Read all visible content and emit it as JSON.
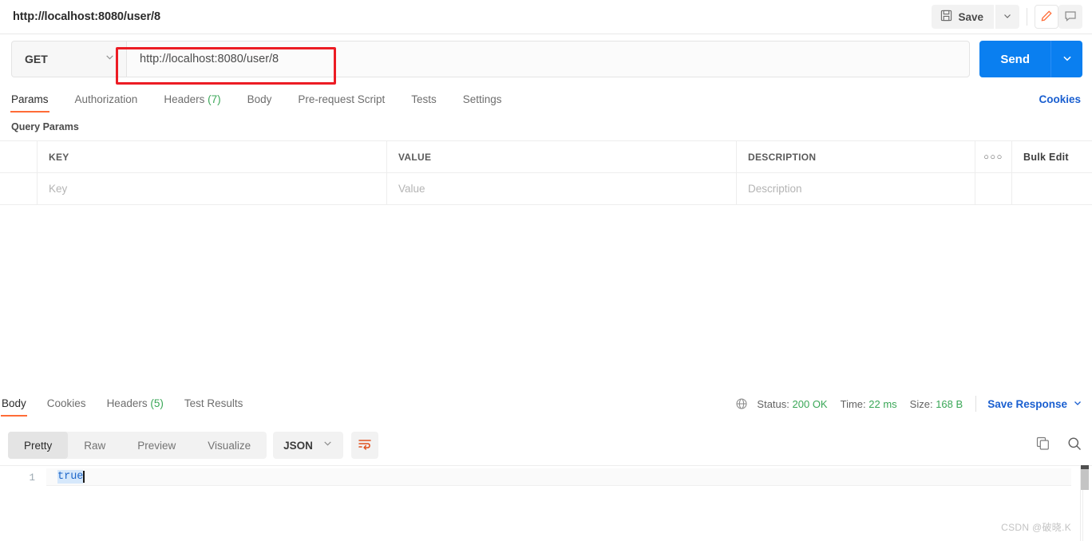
{
  "topbar": {
    "request_title": "http://localhost:8080/user/8",
    "save_label": "Save",
    "save_icon": "floppy-disk-icon",
    "save_caret_icon": "chevron-down-icon",
    "edit_icon": "pencil-icon",
    "comment_icon": "comment-icon",
    "accent_edit_color": "#ff6c37"
  },
  "url_bar": {
    "method": "GET",
    "method_caret_icon": "chevron-down-icon",
    "url": "http://localhost:8080/user/8",
    "send_label": "Send",
    "send_caret_icon": "chevron-down-icon",
    "send_color": "#0a7ff0",
    "highlight_color": "#ec1c24"
  },
  "request_tabs": {
    "items": [
      {
        "label": "Params",
        "active": true
      },
      {
        "label": "Authorization",
        "active": false
      },
      {
        "label": "Headers",
        "count": "(7)",
        "active": false
      },
      {
        "label": "Body",
        "active": false
      },
      {
        "label": "Pre-request Script",
        "active": false
      },
      {
        "label": "Tests",
        "active": false
      },
      {
        "label": "Settings",
        "active": false
      }
    ],
    "cookies_label": "Cookies",
    "active_underline_color": "#ff6c37"
  },
  "query_params": {
    "section_title": "Query Params",
    "columns": [
      "KEY",
      "VALUE",
      "DESCRIPTION"
    ],
    "more_icon": "ellipsis-icon",
    "bulk_edit_label": "Bulk Edit",
    "row_placeholders": {
      "key": "Key",
      "value": "Value",
      "description": "Description"
    }
  },
  "response": {
    "tabs": [
      {
        "label": "Body",
        "active": true
      },
      {
        "label": "Cookies",
        "active": false
      },
      {
        "label": "Headers",
        "count": "(5)",
        "active": false
      },
      {
        "label": "Test Results",
        "active": false
      }
    ],
    "network_icon": "globe-icon",
    "status_label": "Status:",
    "status_value": "200 OK",
    "time_label": "Time:",
    "time_value": "22 ms",
    "size_label": "Size:",
    "size_value": "168 B",
    "save_response_label": "Save Response",
    "save_response_caret_icon": "chevron-down-icon",
    "success_color": "#3aa757"
  },
  "body_toolbar": {
    "views": [
      {
        "label": "Pretty",
        "active": true
      },
      {
        "label": "Raw",
        "active": false
      },
      {
        "label": "Preview",
        "active": false
      },
      {
        "label": "Visualize",
        "active": false
      }
    ],
    "format": "JSON",
    "format_caret_icon": "chevron-down-icon",
    "wrap_icon": "word-wrap-icon",
    "copy_icon": "copy-icon",
    "search_icon": "search-icon"
  },
  "code": {
    "line_number": "1",
    "content": "true"
  },
  "watermark": "CSDN @破晓.K"
}
